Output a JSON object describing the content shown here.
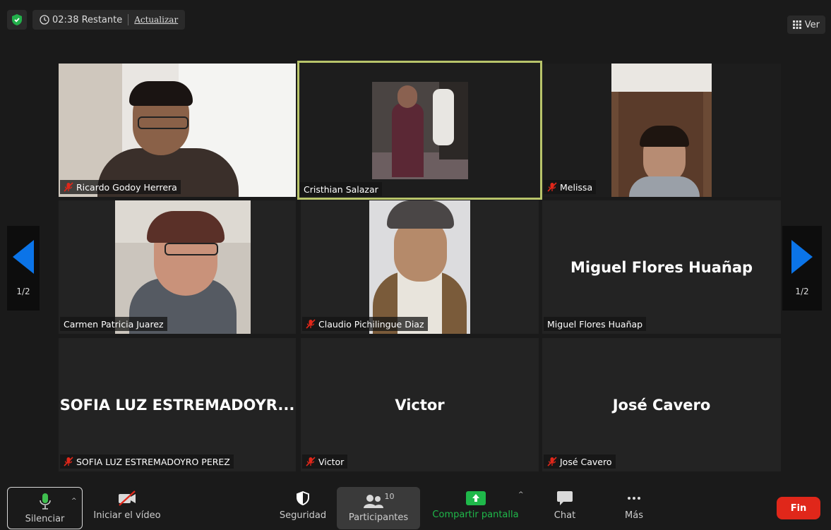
{
  "topbar": {
    "time_remaining": "02:38 Restante",
    "update_link": "Actualizar",
    "view_button": "Ver"
  },
  "paging": {
    "left": "1/2",
    "right": "1/2"
  },
  "participants": [
    {
      "name": "Ricardo Godoy Herrera",
      "muted": true,
      "video": true
    },
    {
      "name": "Cristhian Salazar",
      "muted": false,
      "video": true,
      "active": true
    },
    {
      "name": "Melissa",
      "muted": true,
      "video": true
    },
    {
      "name": "Carmen Patricia Juarez",
      "muted": false,
      "video": true
    },
    {
      "name": "Claudio Pichilingue Diaz",
      "muted": true,
      "video": true
    },
    {
      "name": "Miguel Flores Huañap",
      "display": "Miguel Flores Huañap",
      "muted": false,
      "video": false
    },
    {
      "name": "SOFIA LUZ ESTREMADOYRO PEREZ",
      "display": "SOFIA LUZ ESTREMADOYR...",
      "muted": true,
      "video": false
    },
    {
      "name": "Victor",
      "display": "Victor",
      "muted": true,
      "video": false
    },
    {
      "name": "José Cavero",
      "display": "José Cavero",
      "muted": true,
      "video": false
    }
  ],
  "toolbar": {
    "mute": "Silenciar",
    "video": "Iniciar el vídeo",
    "security": "Seguridad",
    "participants": "Participantes",
    "participants_count": "10",
    "share": "Compartir pantalla",
    "chat": "Chat",
    "more": "Más",
    "end": "Fin"
  },
  "colors": {
    "active_border": "#b8c46a",
    "end_button": "#e0271a",
    "share_green": "#1fb84a",
    "mic_green": "#3fbf4f",
    "nav_blue": "#0b74e8"
  }
}
